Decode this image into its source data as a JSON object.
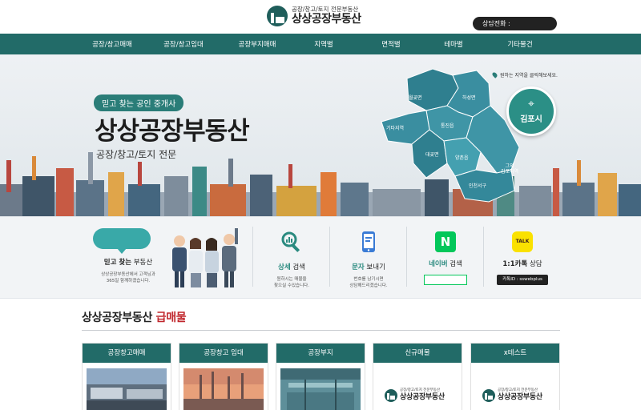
{
  "header": {
    "logo_sub": "공장/창고/토지 전문부동산",
    "logo_main": "상상공장부동산",
    "phone_label": "상담전화 :"
  },
  "nav": {
    "items": [
      "공장/창고매매",
      "공장/창고임대",
      "공장부지매매",
      "지역별",
      "면적별",
      "테마별",
      "기타물건"
    ]
  },
  "banner": {
    "badge": "믿고 찾는 공인 중개사",
    "title": "상상공장부동산",
    "subtitle": "공장/창고/토지 전문",
    "map_hint": "원하는 지역을 클릭해보세요.",
    "highlight": "김포시",
    "regions": [
      "월곶면",
      "하성면",
      "통진읍",
      "기타지역",
      "대곶면",
      "양촌읍",
      "그외\n김포지역",
      "인천서구"
    ]
  },
  "services": {
    "trust": {
      "title_bold": "믿고 찾는",
      "title_rest": " 부동산",
      "desc1": "상상공장부동산에서 고객님과",
      "desc2": "365일 함께하겠습니다."
    },
    "search": {
      "title_green": "상세",
      "title_rest": " 검색",
      "desc1": "원하시는 매물을",
      "desc2": "찾으실 수있습니다."
    },
    "sms": {
      "title_green": "문자",
      "title_rest": " 보내기",
      "desc1": "번호를 남기시면",
      "desc2": "상담해드리겠습니다."
    },
    "naver": {
      "logo": "N",
      "title_green": "네이버",
      "title_rest": " 검색"
    },
    "kakao": {
      "logo": "TALK",
      "title_bold": "1:1카톡",
      "title_rest": " 상담",
      "id_label": "카톡ID : sswebplus"
    }
  },
  "section": {
    "title_main": "상상공장부동산 ",
    "title_red": "급매물"
  },
  "cards": [
    {
      "label": "공장창고매매"
    },
    {
      "label": "공장창고 임대"
    },
    {
      "label": "공장부지"
    },
    {
      "label": "신규매물",
      "logo_sub": "공장/창고/토지 전문부동산",
      "logo_main": "상상공장부동산"
    },
    {
      "label": "x테스트",
      "logo_sub": "공장/창고/토지 전문부동산",
      "logo_main": "상상공장부동산"
    }
  ],
  "colors": {
    "primary": "#226b68",
    "accent_red": "#c0272d",
    "naver": "#03c75a",
    "kakao": "#fae100"
  }
}
